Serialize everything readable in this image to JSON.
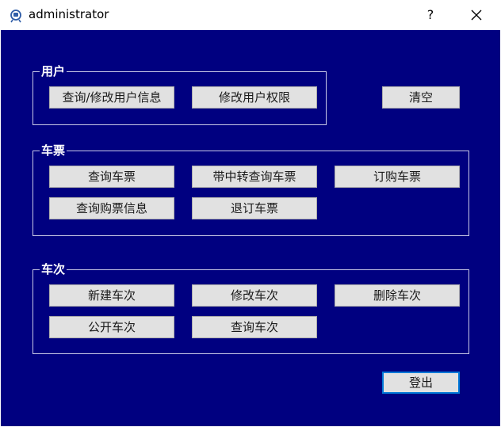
{
  "window": {
    "title": "administrator",
    "help_label": "?"
  },
  "groups": {
    "user": {
      "label": "用户",
      "buttons": [
        "查询/修改用户信息",
        "修改用户权限"
      ]
    },
    "ticket": {
      "label": "车票",
      "buttons": [
        "查询车票",
        "带中转查询车票",
        "订购车票",
        "查询购票信息",
        "退订车票"
      ]
    },
    "train": {
      "label": "车次",
      "buttons": [
        "新建车次",
        "修改车次",
        "删除车次",
        "公开车次",
        "查询车次"
      ]
    }
  },
  "actions": {
    "clear_label": "清空",
    "logout_label": "登出"
  }
}
